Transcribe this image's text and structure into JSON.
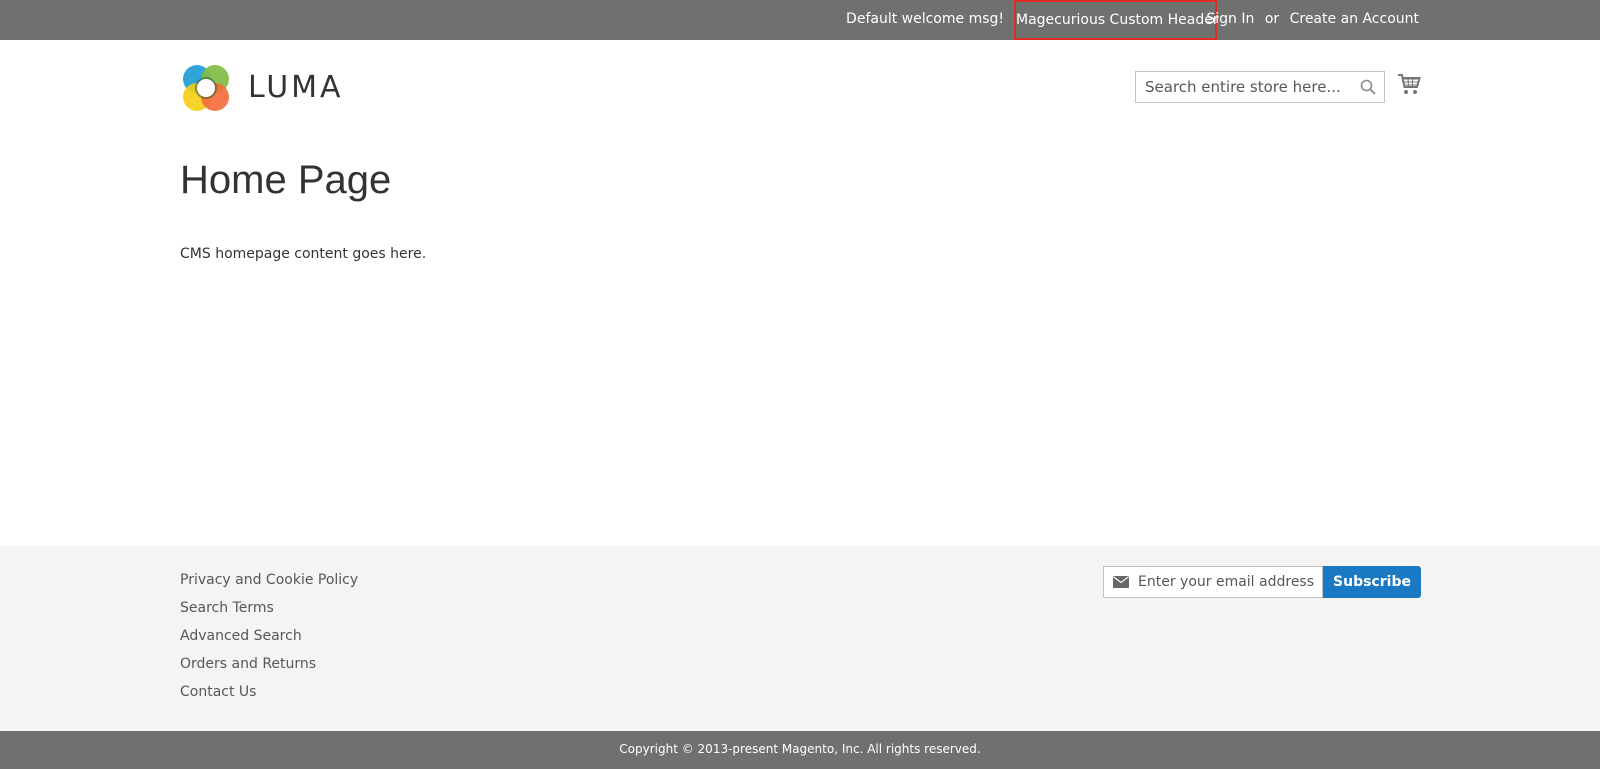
{
  "header": {
    "welcome": "Default welcome msg!",
    "custom_header": "Magecurious Custom Header",
    "sign_in": "Sign In",
    "or": "or",
    "create_account": "Create an Account",
    "bar_color": "#6e716e",
    "highlight_color": "#e02b27"
  },
  "brand": {
    "logo_text": "LUMA"
  },
  "search": {
    "placeholder": "Search entire store here..."
  },
  "main": {
    "title": "Home Page",
    "content": "CMS homepage content goes here."
  },
  "footer": {
    "links": [
      "Privacy and Cookie Policy",
      "Search Terms",
      "Advanced Search",
      "Orders and Returns",
      "Contact Us"
    ],
    "newsletter_placeholder": "Enter your email address",
    "subscribe_label": "Subscribe",
    "accent_color": "#1979c3",
    "copyright": "Copyright © 2013-present Magento, Inc. All rights reserved."
  }
}
